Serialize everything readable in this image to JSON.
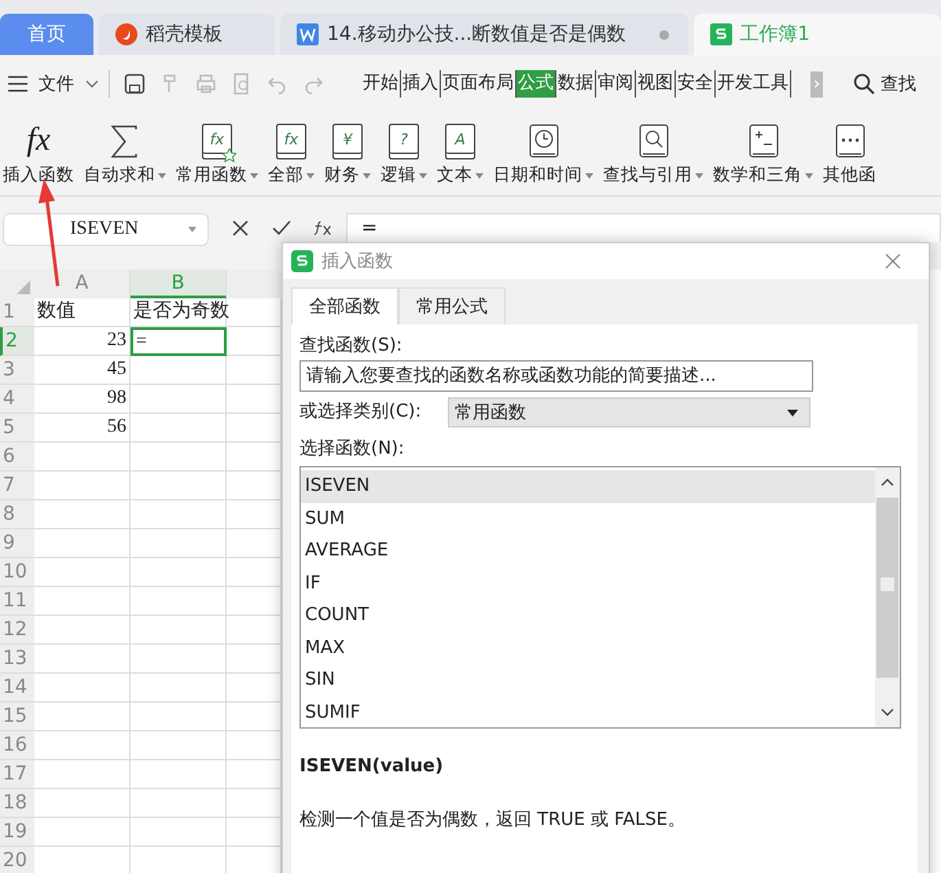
{
  "doc_tabs": [
    {
      "label": "首页",
      "kind": "home",
      "selected": false,
      "modified": false
    },
    {
      "label": "稻壳模板",
      "kind": "docer",
      "selected": false,
      "modified": false
    },
    {
      "label": "14.移动办公技...断数值是否是偶数",
      "kind": "writer",
      "selected": false,
      "modified": true
    },
    {
      "label": "工作簿1",
      "kind": "sheet",
      "selected": true,
      "modified": false
    }
  ],
  "menu": {
    "file_label": "文件",
    "ribbon_tabs": [
      {
        "label": "开始",
        "selected": false
      },
      {
        "label": "插入",
        "selected": false
      },
      {
        "label": "页面布局",
        "selected": false
      },
      {
        "label": "公式",
        "selected": true
      },
      {
        "label": "数据",
        "selected": false
      },
      {
        "label": "审阅",
        "selected": false
      },
      {
        "label": "视图",
        "selected": false
      },
      {
        "label": "安全",
        "selected": false
      },
      {
        "label": "开发工具",
        "selected": false
      }
    ],
    "more": "›",
    "search_label": "查找"
  },
  "ribbon": [
    {
      "label": "插入函数",
      "kind": "fx",
      "has_menu": false
    },
    {
      "label": "自动求和",
      "kind": "sigma",
      "has_menu": true
    },
    {
      "label": "常用函数",
      "kind": "star",
      "glyph": "fx",
      "has_menu": true
    },
    {
      "label": "全部",
      "kind": "book",
      "glyph": "fx",
      "has_menu": true
    },
    {
      "label": "财务",
      "kind": "book",
      "glyph": "¥",
      "has_menu": true
    },
    {
      "label": "逻辑",
      "kind": "book",
      "glyph": "?",
      "has_menu": true
    },
    {
      "label": "文本",
      "kind": "book",
      "glyph": "A",
      "has_menu": true
    },
    {
      "label": "日期和时间",
      "kind": "clock",
      "has_menu": true
    },
    {
      "label": "查找与引用",
      "kind": "lens",
      "has_menu": true
    },
    {
      "label": "数学和三角",
      "kind": "math",
      "has_menu": true
    },
    {
      "label": "其他函",
      "kind": "dots",
      "has_menu": false
    }
  ],
  "formula_bar": {
    "name_box": "ISEVEN",
    "formula": "="
  },
  "sheet": {
    "columns": [
      {
        "label": "A",
        "selected": false
      },
      {
        "label": "B",
        "selected": true
      }
    ],
    "rows": [
      {
        "label": "1",
        "selected": false,
        "cells": [
          "数值",
          "是否为奇数"
        ]
      },
      {
        "label": "2",
        "selected": true,
        "cells": [
          "23",
          "="
        ]
      },
      {
        "label": "3",
        "selected": false,
        "cells": [
          "45",
          ""
        ]
      },
      {
        "label": "4",
        "selected": false,
        "cells": [
          "98",
          ""
        ]
      },
      {
        "label": "5",
        "selected": false,
        "cells": [
          "56",
          ""
        ]
      },
      {
        "label": "6",
        "selected": false,
        "cells": [
          "",
          ""
        ]
      },
      {
        "label": "7",
        "selected": false,
        "cells": [
          "",
          ""
        ]
      },
      {
        "label": "8",
        "selected": false,
        "cells": [
          "",
          ""
        ]
      },
      {
        "label": "9",
        "selected": false,
        "cells": [
          "",
          ""
        ]
      },
      {
        "label": "10",
        "selected": false,
        "cells": [
          "",
          ""
        ]
      },
      {
        "label": "11",
        "selected": false,
        "cells": [
          "",
          ""
        ]
      },
      {
        "label": "12",
        "selected": false,
        "cells": [
          "",
          ""
        ]
      },
      {
        "label": "13",
        "selected": false,
        "cells": [
          "",
          ""
        ]
      },
      {
        "label": "14",
        "selected": false,
        "cells": [
          "",
          ""
        ]
      },
      {
        "label": "15",
        "selected": false,
        "cells": [
          "",
          ""
        ]
      },
      {
        "label": "16",
        "selected": false,
        "cells": [
          "",
          ""
        ]
      },
      {
        "label": "17",
        "selected": false,
        "cells": [
          "",
          ""
        ]
      },
      {
        "label": "18",
        "selected": false,
        "cells": [
          "",
          ""
        ]
      },
      {
        "label": "19",
        "selected": false,
        "cells": [
          "",
          ""
        ]
      },
      {
        "label": "20",
        "selected": false,
        "cells": [
          "",
          ""
        ]
      }
    ]
  },
  "dialog": {
    "title": "插入函数",
    "tabs": [
      {
        "label": "全部函数",
        "selected": true
      },
      {
        "label": "常用公式",
        "selected": false
      }
    ],
    "search_label": "查找函数(S):",
    "search_placeholder": "请输入您要查找的函数名称或函数功能的简要描述...",
    "category_label": "或选择类别(C):",
    "category": "常用函数",
    "list_label": "选择函数(N):",
    "functions": [
      {
        "name": "ISEVEN",
        "selected": true
      },
      {
        "name": "SUM",
        "selected": false
      },
      {
        "name": "AVERAGE",
        "selected": false
      },
      {
        "name": "IF",
        "selected": false
      },
      {
        "name": "COUNT",
        "selected": false
      },
      {
        "name": "MAX",
        "selected": false
      },
      {
        "name": "SIN",
        "selected": false
      },
      {
        "name": "SUMIF",
        "selected": false
      }
    ],
    "signature": "ISEVEN(value)",
    "description": "检测一个值是否为偶数，返回 TRUE 或 FALSE。"
  }
}
